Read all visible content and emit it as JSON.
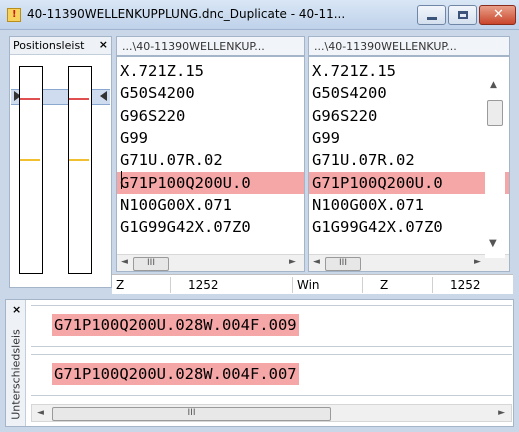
{
  "window": {
    "title": "40-11390WELLENKUPPLUNG.dnc_Duplicate - 40-11...",
    "min_icon": "minimize-icon",
    "max_icon": "maximize-icon",
    "close_icon": "close-icon",
    "close_glyph": "✕"
  },
  "position_panel": {
    "title": "Positionsleist",
    "close_glyph": "×"
  },
  "left_pane": {
    "header": "...\\40-11390WELLENKUP...",
    "lines": [
      "X.721Z.15",
      "G50S4200",
      "G96S220",
      "G99",
      "G71U.07R.02",
      "G71P100Q200U.0",
      "N100G00X.071",
      "G1G99G42X.07Z0"
    ],
    "scroll_thumb": "III"
  },
  "right_pane": {
    "header": "...\\40-11390WELLENKUP...",
    "lines": [
      "X.721Z.15",
      "G50S4200",
      "G96S220",
      "G99",
      "G71U.07R.02",
      "G71P100Q200U.0",
      "N100G00X.071",
      "G1G99G42X.07Z0"
    ],
    "scroll_thumb": "III"
  },
  "diff_line_index": 5,
  "status": {
    "left_label": "Z",
    "left_value": "1252",
    "mode": "Win",
    "right_label": "Z",
    "right_value": "1252"
  },
  "bottom_panel": {
    "title": "Unterschiedsleis",
    "close_glyph": "×",
    "line_1": "G71P100Q200U.028W.004F.009",
    "line_2": "G71P100Q200U.028W.004F.007",
    "scroll_thumb": "III"
  },
  "colors": {
    "diff_highlight": "#f5a6a6",
    "marker_red": "#e05050",
    "marker_yellow": "#f0c030"
  }
}
